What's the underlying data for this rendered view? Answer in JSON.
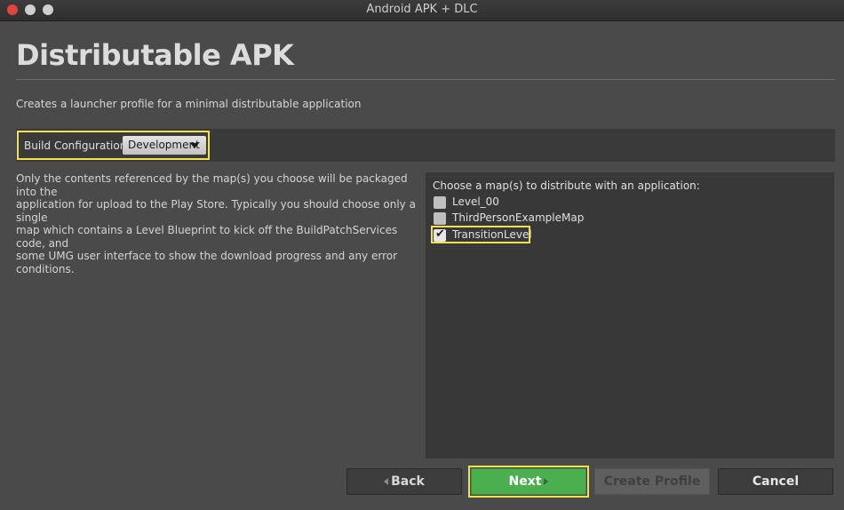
{
  "window": {
    "title": "Android APK + DLC"
  },
  "page": {
    "heading": "Distributable APK",
    "subtitle": "Creates a launcher profile for a minimal distributable application"
  },
  "build_config": {
    "label": "Build Configuration:",
    "selected": "Development"
  },
  "description": {
    "line1": "Only the contents referenced by the map(s) you choose will be packaged into the",
    "line2": "application for upload to the Play Store. Typically you should choose only a single",
    "line3": "map which contains a Level Blueprint to kick off the BuildPatchServices code, and",
    "line4": "some UMG user interface to show the download progress and any error conditions."
  },
  "maps": {
    "prompt": "Choose a map(s) to distribute with an application:",
    "items": [
      {
        "name": "Level_00",
        "checked": false
      },
      {
        "name": "ThirdPersonExampleMap",
        "checked": false
      },
      {
        "name": "TransitionLevel",
        "checked": true
      }
    ]
  },
  "buttons": {
    "back": "Back",
    "next": "Next",
    "create_profile": "Create Profile",
    "cancel": "Cancel"
  },
  "colors": {
    "highlight": "#f2e14a",
    "next_button": "#4caf4f"
  }
}
